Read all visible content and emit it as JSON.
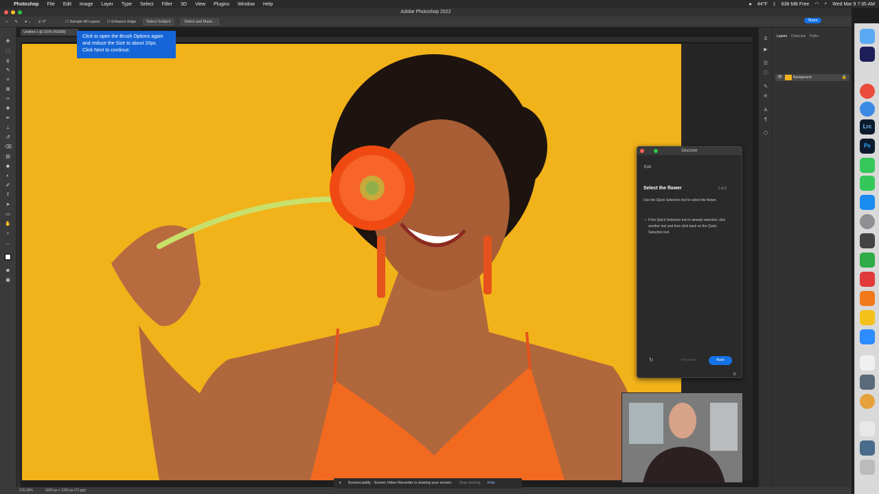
{
  "menubar": {
    "app": "Photoshop",
    "items": [
      "File",
      "Edit",
      "Image",
      "Layer",
      "Type",
      "Select",
      "Filter",
      "3D",
      "View",
      "Plugins",
      "Window",
      "Help"
    ],
    "weather": "44°F",
    "memory": "838 MB Free",
    "datetime": "Wed Mar 9  7:35 AM"
  },
  "titlebar": {
    "title": "Adobe Photoshop 2022"
  },
  "optionsbar": {
    "sample_all_layers": "Sample All Layers",
    "enhance_edge": "Enhance Edge",
    "select_subject": "Select Subject",
    "select_and_mask": "Select and Mask...",
    "share": "Share"
  },
  "document": {
    "tab_title": "Untitled-1 @ 215% (RGB/8)",
    "zoom": "215.33%",
    "dimensions": "1600 px x 1200 px (72 ppi)"
  },
  "tooltip": {
    "lines": [
      "Click to open the Brush Options again",
      "and reduce the Size to about 20px.",
      "Click Next to continue."
    ]
  },
  "discover": {
    "header": "Discover",
    "exit": "Exit",
    "title": "Select the flower",
    "counter": "1 of 2",
    "description": "Use the Quick Selection tool to select the flower.",
    "bullet": "If the Quick Selection tool is already selected, click another tool and then click back on the Quick Selection tool.",
    "previous": "Previous",
    "next": "Next"
  },
  "layers": {
    "tabs": [
      "Layers",
      "Channels",
      "Paths"
    ],
    "layer_name": "Background"
  },
  "screencastify": {
    "message": "Screencastify - Screen Video Recorder is sharing your screen.",
    "stop": "Stop sharing",
    "hide": "Hide"
  },
  "dock": {
    "apps": [
      "Lrc",
      "Ps"
    ]
  },
  "colors": {
    "canvas_bg": "#f1b21a",
    "accent": "#1473e6",
    "tooltip_bg": "#1565d8"
  }
}
